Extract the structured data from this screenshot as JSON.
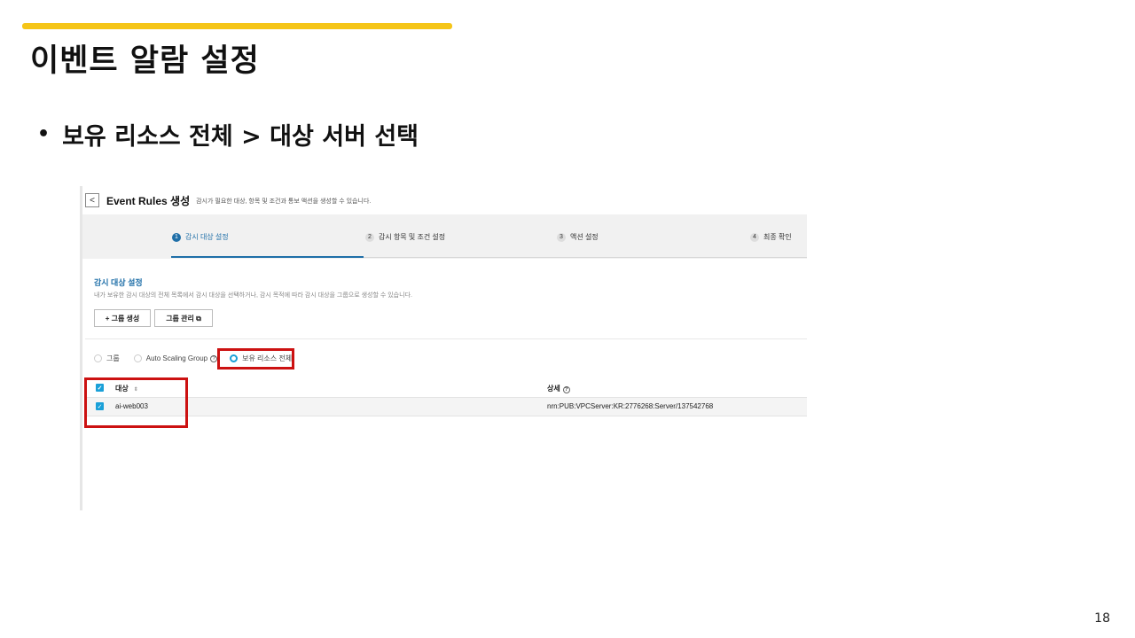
{
  "slide": {
    "title": "이벤트 알람 설정",
    "bullet": "보유 리소스 전체 > 대상 서버 선택",
    "bullet_marker": "•",
    "page_number": "18",
    "accent_color": "#f5c518"
  },
  "screenshot": {
    "header": {
      "back_icon": "chevron-left-icon",
      "back_glyph": "<",
      "title": "Event Rules 생성",
      "description": "감시가 필요한 대상, 항목 및 조건과 통보 액션을 생성할 수 있습니다."
    },
    "steps": [
      {
        "num": "1",
        "label": "감시 대상 설정",
        "active": true
      },
      {
        "num": "2",
        "label": "감시 항목 및 조건 설정",
        "active": false
      },
      {
        "num": "3",
        "label": "액션 설정",
        "active": false
      },
      {
        "num": "4",
        "label": "최종 확인",
        "active": false
      }
    ],
    "section": {
      "title": "감시 대상 설정",
      "description": "내가 보유한 감시 대상의 전체 목록에서 감시 대상을 선택하거나, 감시 목적에 따라 감시 대상을 그룹으로 생성할 수 있습니다."
    },
    "buttons": {
      "create_group": "+ 그룹 생성",
      "manage_group": "그룹 관리 ⧉"
    },
    "radios": [
      {
        "label": "그룹",
        "checked": false
      },
      {
        "label": "Auto Scaling Group",
        "checked": false,
        "help_glyph": "?"
      },
      {
        "label": "보유 리소스 전체",
        "checked": true
      }
    ],
    "table": {
      "columns": [
        "대상",
        "상세"
      ],
      "sort_glyph": "⇕",
      "help_glyph": "?",
      "check_glyph": "✓",
      "rows": [
        {
          "target": "ai-web003",
          "detail": "nrn:PUB:VPCServer:KR:2776268:Server/137542768",
          "checked": true
        }
      ]
    },
    "accent_color": "#1f6fa8",
    "highlight_color": "#cc1111"
  }
}
